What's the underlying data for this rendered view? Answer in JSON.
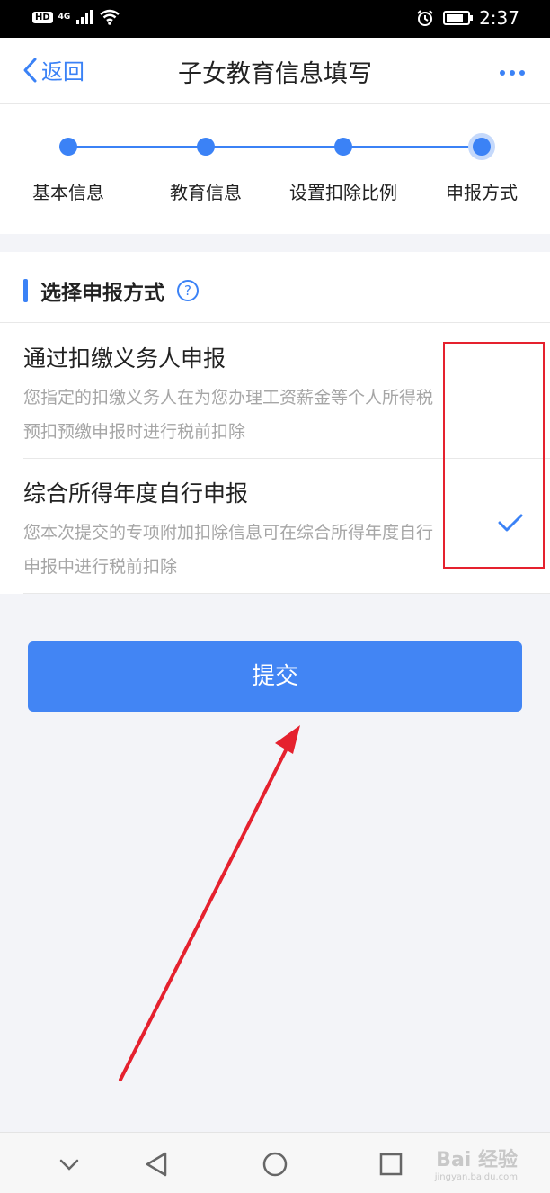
{
  "status_bar": {
    "hd": "HD",
    "signal": "4G",
    "time": "2:37"
  },
  "nav": {
    "back_label": "返回",
    "title": "子女教育信息填写"
  },
  "steps": [
    {
      "label": "基本信息"
    },
    {
      "label": "教育信息"
    },
    {
      "label": "设置扣除比例"
    },
    {
      "label": "申报方式",
      "active": true
    }
  ],
  "section": {
    "title": "选择申报方式",
    "help_glyph": "?"
  },
  "options": [
    {
      "title": "通过扣缴义务人申报",
      "description": "您指定的扣缴义务人在为您办理工资薪金等个人所得税预扣预缴申报时进行税前扣除",
      "selected": false
    },
    {
      "title": "综合所得年度自行申报",
      "description": "您本次提交的专项附加扣除信息可在综合所得年度自行申报中进行税前扣除",
      "selected": true
    }
  ],
  "submit_label": "提交",
  "watermark": {
    "main": "Bai 经验",
    "sub": "jingyan.baidu.com"
  },
  "colors": {
    "accent": "#3b82f6",
    "button": "#4285f4",
    "annotation": "#e5212e"
  },
  "icons": [
    "back-chevron-icon",
    "more-dots-icon",
    "help-circle-icon",
    "checkmark-icon",
    "alarm-icon",
    "battery-icon",
    "wifi-icon"
  ]
}
